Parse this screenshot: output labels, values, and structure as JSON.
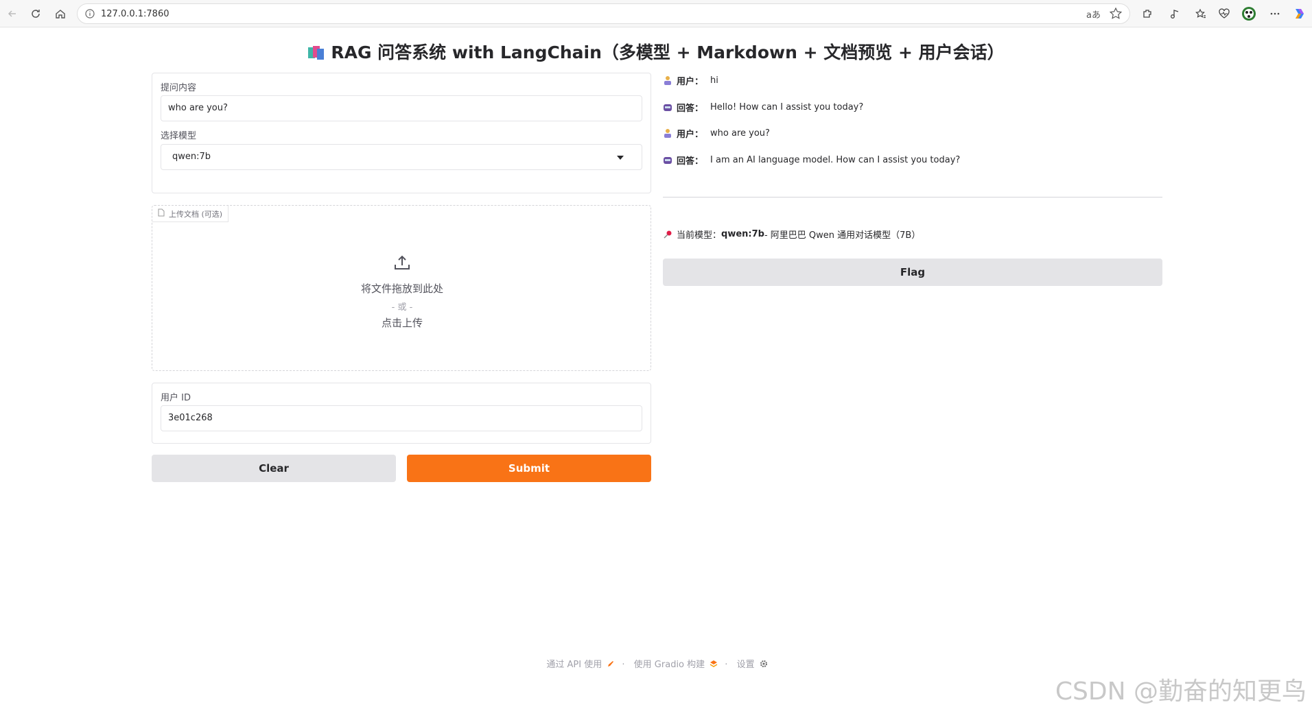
{
  "browser": {
    "url": "127.0.0.1:7860",
    "read_aloud": "aあ"
  },
  "app": {
    "title": "RAG 问答系统 with LangChain（多模型 + Markdown + 文档预览 + 用户会话）"
  },
  "question": {
    "label": "提问内容",
    "value": "who are you?"
  },
  "model_select": {
    "label": "选择模型",
    "value": "qwen:7b"
  },
  "upload": {
    "tag": "上传文档 (可选)",
    "drop_text": "将文件拖放到此处",
    "or_text": "- 或 -",
    "click_text": "点击上传"
  },
  "user_id": {
    "label": "用户 ID",
    "value": "3e01c268"
  },
  "buttons": {
    "clear": "Clear",
    "submit": "Submit",
    "flag": "Flag"
  },
  "chat": [
    {
      "who": "用户：",
      "text": "hi",
      "role": "user"
    },
    {
      "who": "回答：",
      "text": "Hello! How can I assist you today?",
      "role": "bot"
    },
    {
      "who": "用户：",
      "text": "who are you?",
      "role": "user"
    },
    {
      "who": "回答：",
      "text": "I am an AI language model. How can I assist you today?",
      "role": "bot"
    }
  ],
  "current_model": {
    "prefix": "当前模型：",
    "name": "qwen:7b",
    "desc": " - 阿里巴巴 Qwen 通用对话模型（7B）"
  },
  "footer": {
    "api": "通过 API 使用",
    "sep": "·",
    "built": "使用 Gradio 构建",
    "settings": "设置"
  },
  "watermark": "CSDN @勤奋的知更鸟",
  "colors": {
    "primary": "#f97316",
    "secondary": "#e4e4e7"
  }
}
